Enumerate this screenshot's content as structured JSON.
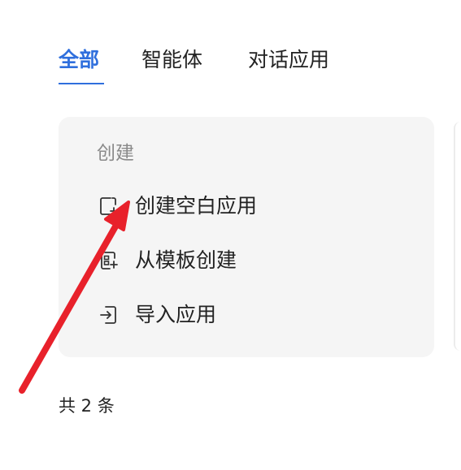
{
  "tabs": [
    {
      "label": "全部",
      "active": true
    },
    {
      "label": "智能体",
      "active": false
    },
    {
      "label": "对话应用",
      "active": false
    }
  ],
  "create_panel": {
    "title": "创建",
    "items": [
      {
        "label": "创建空白应用",
        "icon": "blank-file-add-icon"
      },
      {
        "label": "从模板创建",
        "icon": "template-add-icon"
      },
      {
        "label": "导入应用",
        "icon": "import-icon"
      }
    ]
  },
  "footer": {
    "count_text": "共 2 条"
  },
  "colors": {
    "accent": "#2f6fdd",
    "annotation_arrow": "#e8212b",
    "panel_bg": "#f5f5f5",
    "muted_text": "#8a8a8a"
  }
}
